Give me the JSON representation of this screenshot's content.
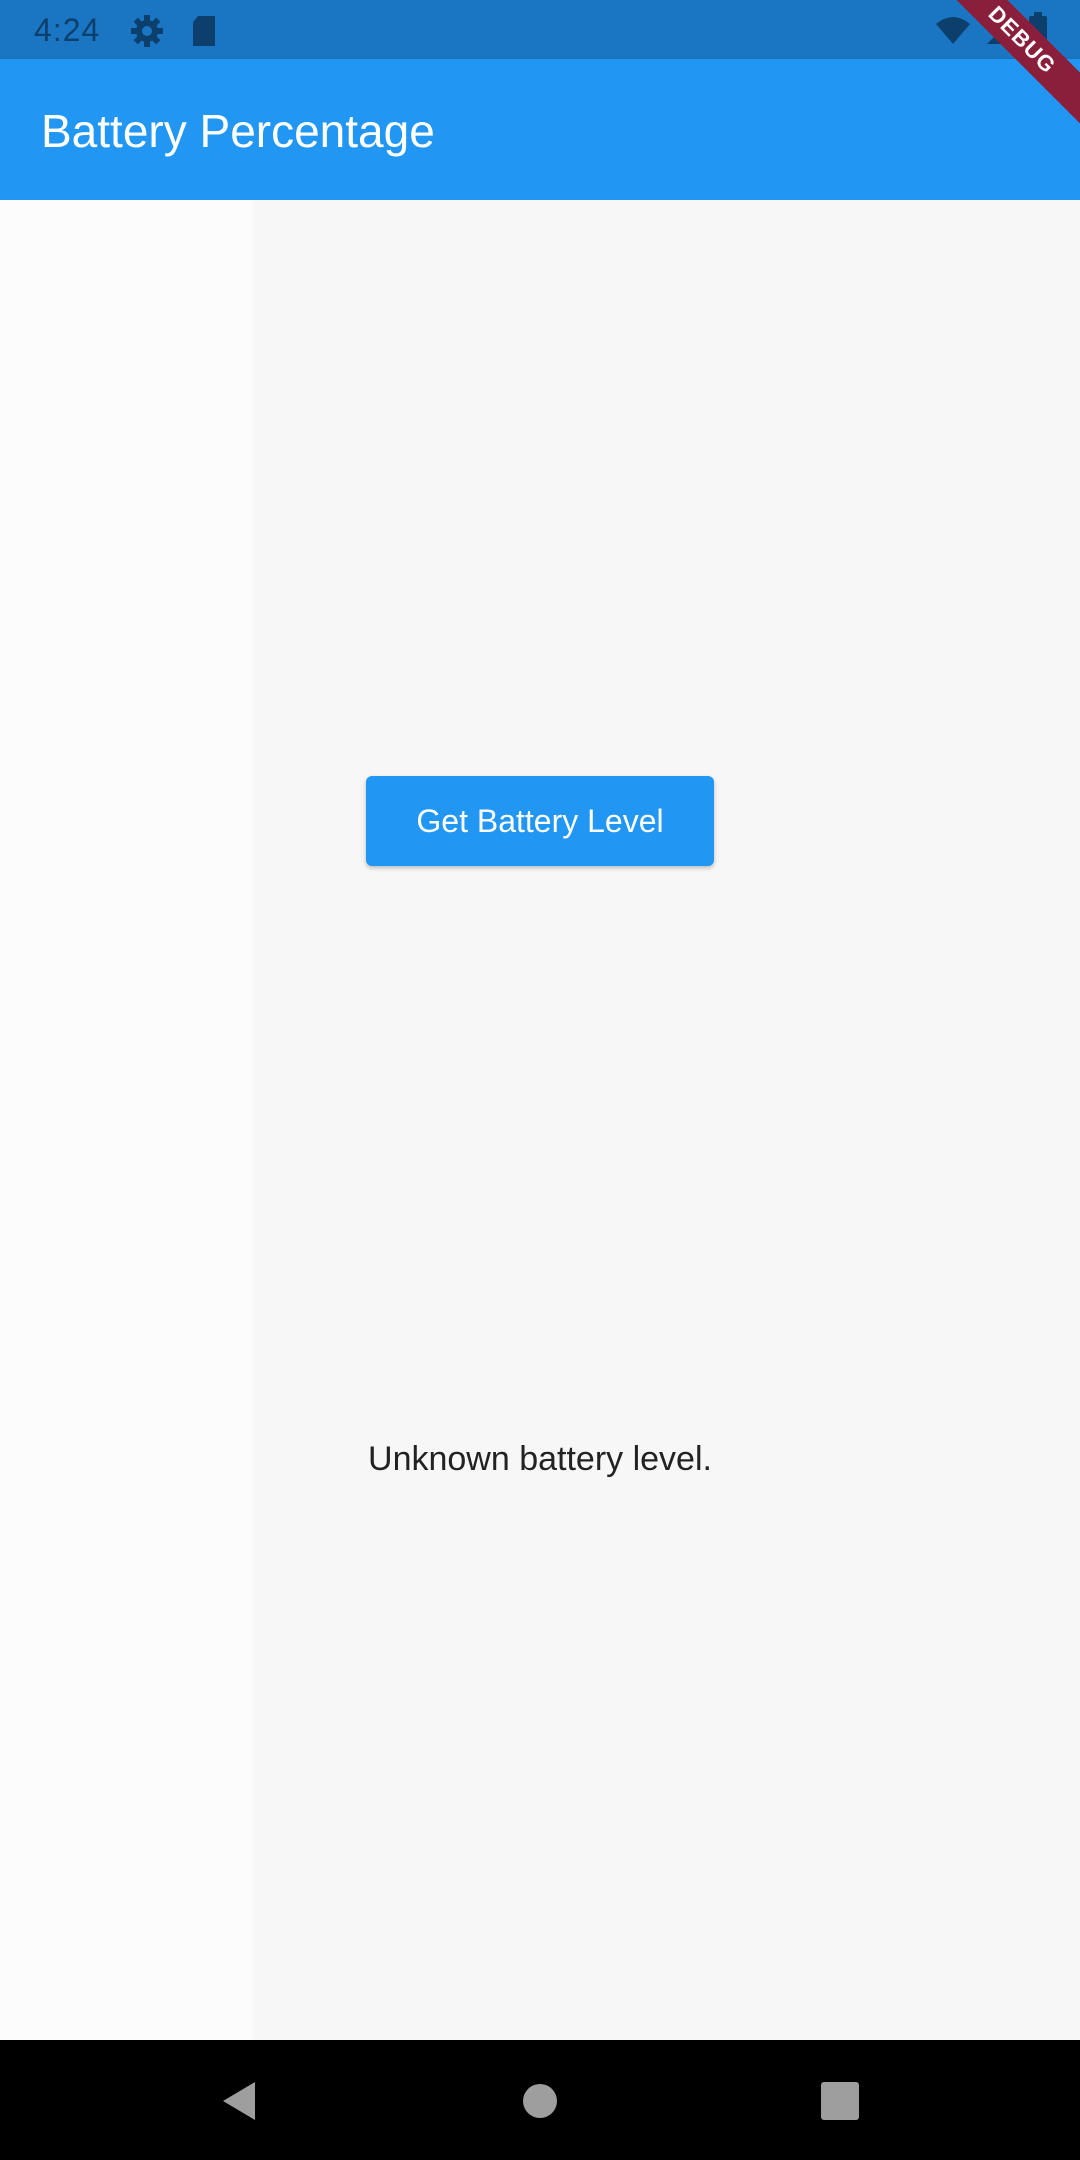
{
  "status_bar": {
    "time": "4:24",
    "icons_left": [
      "settings-gear-icon",
      "sd-card-icon"
    ],
    "icons_right": [
      "wifi-icon",
      "cell-signal-icon",
      "battery-icon"
    ]
  },
  "app_bar": {
    "title": "Battery Percentage",
    "debug_banner": "DEBUG",
    "color": "#2196f3"
  },
  "main": {
    "button_label": "Get Battery Level",
    "battery_status": "Unknown battery level."
  },
  "nav_bar": {
    "buttons": [
      "back-icon",
      "home-icon",
      "recents-icon"
    ]
  }
}
